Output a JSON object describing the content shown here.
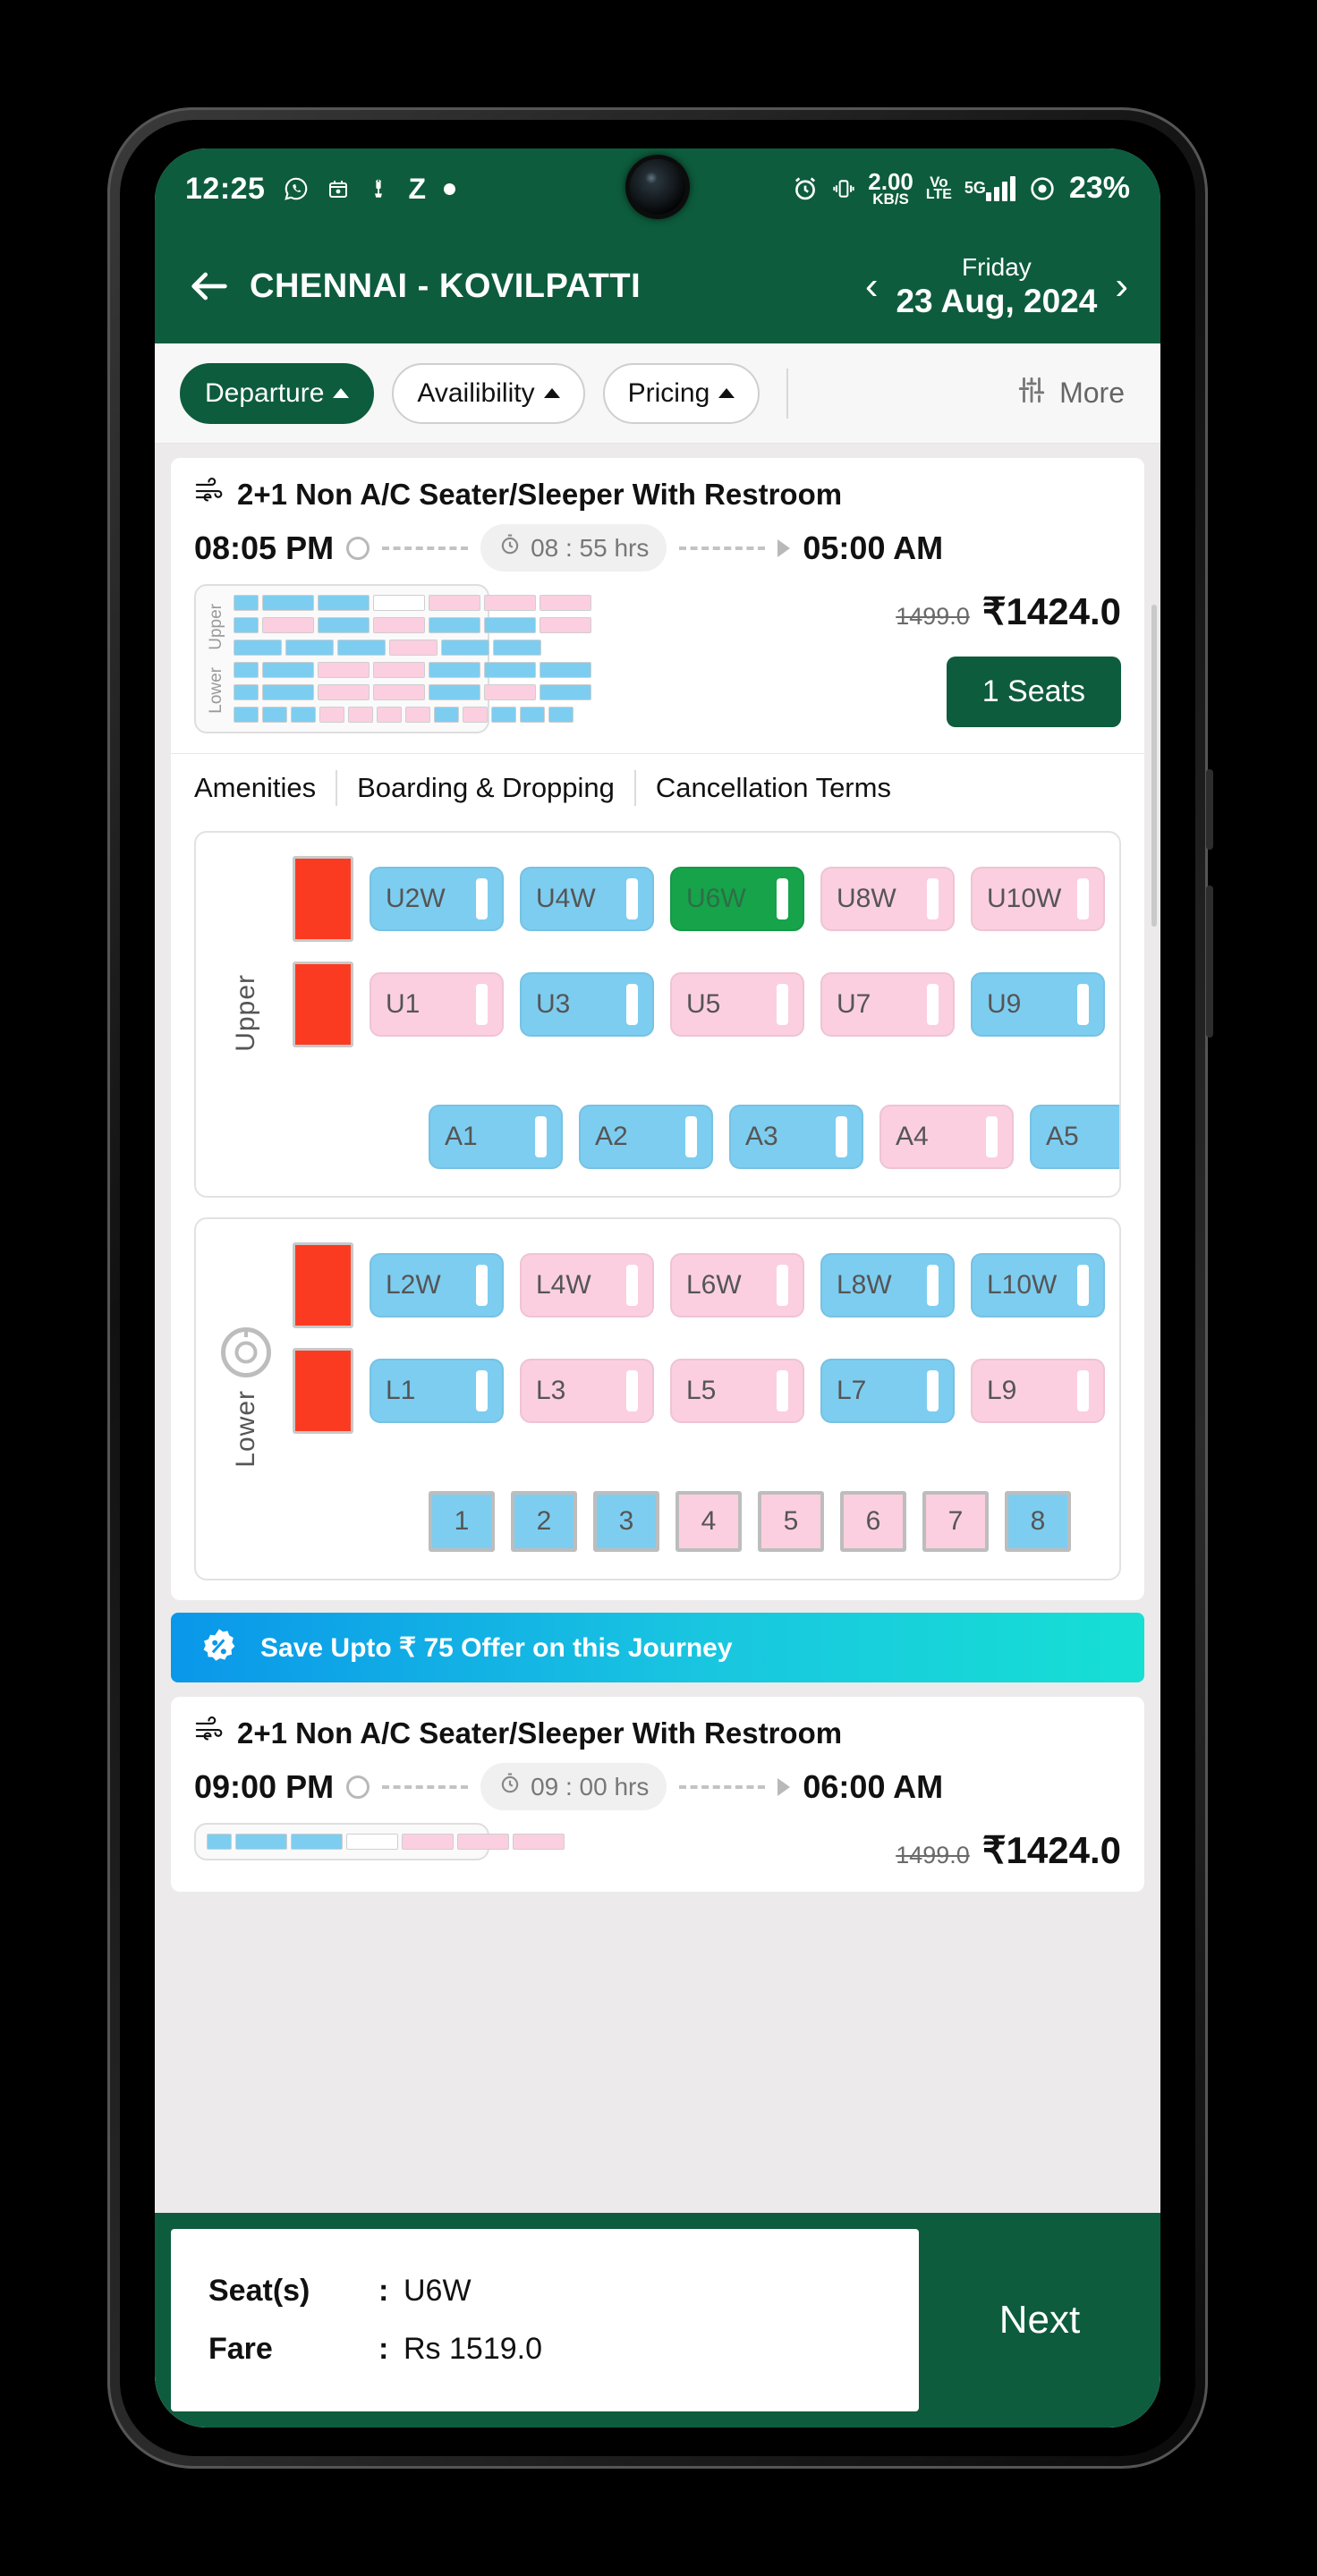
{
  "status_bar": {
    "time": "12:25",
    "left_icons": [
      "whatsapp-icon",
      "calendar-icon",
      "scooter-icon",
      "zomato-icon",
      "dot-icon"
    ],
    "alarm_icon": "alarm-icon",
    "vibrate_icon": "vibrate-icon",
    "net_speed_value": "2.00",
    "net_speed_unit": "KB/S",
    "volte_top": "Vo",
    "volte_bottom": "LTE",
    "network_type": "5G",
    "battery": "23%"
  },
  "header": {
    "back_icon": "back-arrow-icon",
    "route": "CHENNAI - KOVILPATTI",
    "prev_icon": "chevron-left-icon",
    "day": "Friday",
    "date": "23 Aug, 2024",
    "next_icon": "chevron-right-icon"
  },
  "filters": {
    "items": [
      {
        "label": "Departure",
        "active": true
      },
      {
        "label": "Availibility",
        "active": false
      },
      {
        "label": "Pricing",
        "active": false
      }
    ],
    "more_label": "More",
    "more_icon": "sliders-icon"
  },
  "bus_cards": [
    {
      "bus_icon": "ac-air-icon",
      "type": "2+1 Non A/C Seater/Sleeper With Restroom",
      "departure": "08:05 PM",
      "duration": "08 : 55 hrs",
      "duration_icon": "stopwatch-icon",
      "arrival": "05:00 AM",
      "old_price": "1499.0",
      "price": "₹1424.0",
      "seats_button": "1 Seats",
      "tabs": [
        "Amenities",
        "Boarding & Dropping",
        "Cancellation Terms"
      ]
    },
    {
      "bus_icon": "ac-air-icon",
      "type": "2+1 Non A/C Seater/Sleeper With Restroom",
      "departure": "09:00 PM",
      "duration": "09 : 00 hrs",
      "duration_icon": "stopwatch-icon",
      "arrival": "06:00 AM",
      "old_price": "1499.0",
      "price": "₹1424.0"
    }
  ],
  "mini_map": {
    "upper_label": "Upper",
    "lower_label": "Lower",
    "upper_rows": [
      [
        {
          "c": "blue",
          "w": 26
        },
        {
          "c": "blue",
          "w": 56
        },
        {
          "c": "blue",
          "w": 56
        },
        {
          "c": "white",
          "w": 56
        },
        {
          "c": "pink",
          "w": 56
        },
        {
          "c": "pink",
          "w": 56
        },
        {
          "c": "pink",
          "w": 56
        }
      ],
      [
        {
          "c": "blue",
          "w": 26
        },
        {
          "c": "pink",
          "w": 56
        },
        {
          "c": "blue",
          "w": 56
        },
        {
          "c": "pink",
          "w": 56
        },
        {
          "c": "blue",
          "w": 56
        },
        {
          "c": "blue",
          "w": 56
        },
        {
          "c": "pink",
          "w": 56
        }
      ],
      [
        {
          "c": "blue",
          "w": 52
        },
        {
          "c": "blue",
          "w": 52
        },
        {
          "c": "blue",
          "w": 52
        },
        {
          "c": "pink",
          "w": 52
        },
        {
          "c": "blue",
          "w": 52
        },
        {
          "c": "blue",
          "w": 52
        }
      ]
    ],
    "lower_rows": [
      [
        {
          "c": "blue",
          "w": 26
        },
        {
          "c": "blue",
          "w": 56
        },
        {
          "c": "pink",
          "w": 56
        },
        {
          "c": "pink",
          "w": 56
        },
        {
          "c": "blue",
          "w": 56
        },
        {
          "c": "blue",
          "w": 56
        },
        {
          "c": "blue",
          "w": 56
        }
      ],
      [
        {
          "c": "blue",
          "w": 26
        },
        {
          "c": "blue",
          "w": 56
        },
        {
          "c": "pink",
          "w": 56
        },
        {
          "c": "pink",
          "w": 56
        },
        {
          "c": "blue",
          "w": 56
        },
        {
          "c": "pink",
          "w": 56
        },
        {
          "c": "blue",
          "w": 56
        }
      ],
      [
        {
          "c": "blue",
          "w": 26
        },
        {
          "c": "blue",
          "w": 26
        },
        {
          "c": "blue",
          "w": 26
        },
        {
          "c": "pink",
          "w": 26
        },
        {
          "c": "pink",
          "w": 26
        },
        {
          "c": "pink",
          "w": 26
        },
        {
          "c": "pink",
          "w": 26
        },
        {
          "c": "blue",
          "w": 26
        },
        {
          "c": "pink",
          "w": 26
        },
        {
          "c": "blue",
          "w": 26
        },
        {
          "c": "blue",
          "w": 26
        },
        {
          "c": "blue",
          "w": 26
        }
      ]
    ]
  },
  "seat_map": {
    "upper": {
      "label": "Upper",
      "rows": [
        {
          "wc": true,
          "seats": [
            {
              "id": "U2W",
              "state": "blue"
            },
            {
              "id": "U4W",
              "state": "blue"
            },
            {
              "id": "U6W",
              "state": "selected"
            },
            {
              "id": "U8W",
              "state": "pink"
            },
            {
              "id": "U10W",
              "state": "pink"
            }
          ]
        },
        {
          "wc": true,
          "seats": [
            {
              "id": "U1",
              "state": "pink"
            },
            {
              "id": "U3",
              "state": "blue"
            },
            {
              "id": "U5",
              "state": "pink"
            },
            {
              "id": "U7",
              "state": "pink"
            },
            {
              "id": "U9",
              "state": "blue"
            }
          ]
        },
        {
          "wc": false,
          "indent": true,
          "seats": [
            {
              "id": "A1",
              "state": "blue"
            },
            {
              "id": "A2",
              "state": "blue"
            },
            {
              "id": "A3",
              "state": "blue"
            },
            {
              "id": "A4",
              "state": "pink"
            },
            {
              "id": "A5",
              "state": "blue"
            }
          ]
        }
      ]
    },
    "lower": {
      "label": "Lower",
      "wheel_icon": "steering-wheel-icon",
      "rows": [
        {
          "wc": true,
          "seats": [
            {
              "id": "L2W",
              "state": "blue"
            },
            {
              "id": "L4W",
              "state": "pink"
            },
            {
              "id": "L6W",
              "state": "pink"
            },
            {
              "id": "L8W",
              "state": "blue"
            },
            {
              "id": "L10W",
              "state": "blue"
            }
          ]
        },
        {
          "wc": true,
          "seats": [
            {
              "id": "L1",
              "state": "blue"
            },
            {
              "id": "L3",
              "state": "pink"
            },
            {
              "id": "L5",
              "state": "pink"
            },
            {
              "id": "L7",
              "state": "blue"
            },
            {
              "id": "L9",
              "state": "pink"
            }
          ]
        },
        {
          "wc": false,
          "indent": true,
          "square": true,
          "seats": [
            {
              "id": "1",
              "state": "blue"
            },
            {
              "id": "2",
              "state": "blue"
            },
            {
              "id": "3",
              "state": "blue"
            },
            {
              "id": "4",
              "state": "pink"
            },
            {
              "id": "5",
              "state": "pink"
            },
            {
              "id": "6",
              "state": "pink"
            },
            {
              "id": "7",
              "state": "pink"
            },
            {
              "id": "8",
              "state": "blue"
            }
          ]
        }
      ]
    }
  },
  "offer": {
    "icon": "discount-badge-icon",
    "text": "Save Upto ₹ 75 Offer on this Journey"
  },
  "bottom_bar": {
    "seat_key": "Seat(s)",
    "seat_sep": ":",
    "seat_value": "U6W",
    "fare_key": "Fare",
    "fare_sep": ":",
    "fare_value": "Rs 1519.0",
    "next_label": "Next"
  },
  "colors": {
    "brand_green": "#0d5c3d",
    "selected_seat": "#16a34a",
    "available_male": "#7dcdf0",
    "available_female": "#fbcfe0",
    "offer_gradient_start": "#0a97ea",
    "offer_gradient_end": "#16dfd4"
  }
}
